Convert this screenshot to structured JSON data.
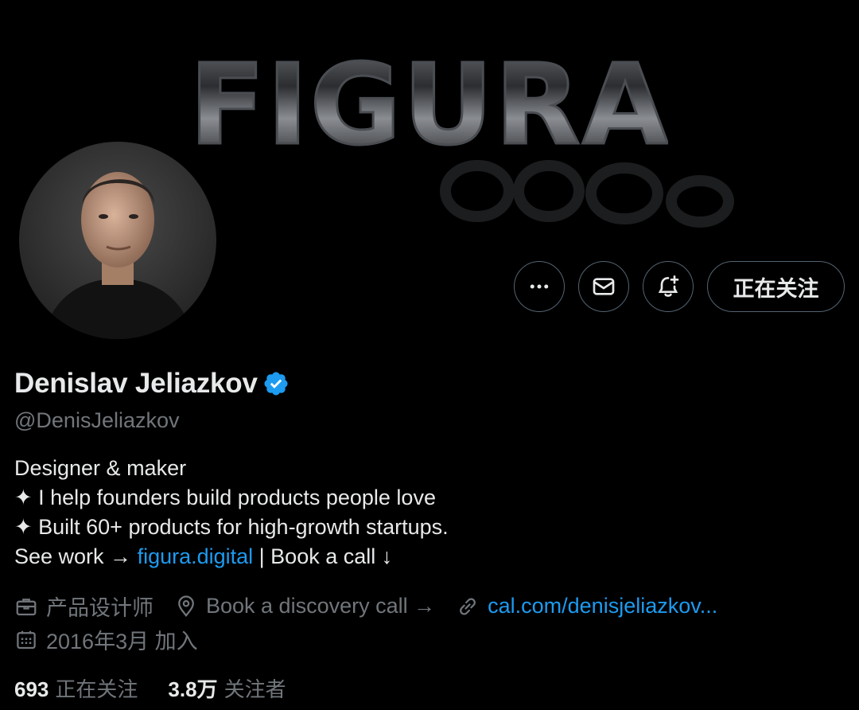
{
  "banner": {
    "logo_text": "FIGURA"
  },
  "actions": {
    "more_icon": "more-horizontal-icon",
    "message_icon": "envelope-icon",
    "notify_icon": "bell-plus-icon",
    "following_label": "正在关注"
  },
  "profile": {
    "display_name": "Denislav Jeliazkov",
    "verified_color": "#1d9bf0",
    "handle": "@DenisJeliazkov",
    "bio": {
      "line1": "Designer & maker",
      "line2": "✦ I help founders build products people love",
      "line3": "✦ Built 60+ products for high-growth startups.",
      "line4_prefix": "See work → ",
      "line4_link": "figura.digital",
      "line4_suffix": " | Book a call ↓"
    },
    "meta": {
      "profession": "产品设计师",
      "location": "Book a discovery call →",
      "website": "cal.com/denisjeliazkov...",
      "joined": "2016年3月 加入"
    },
    "counts": {
      "following_num": "693",
      "following_label": "正在关注",
      "followers_num": "3.8万",
      "followers_label": "关注者"
    }
  },
  "colors": {
    "background": "#000000",
    "text_primary": "#e7e9ea",
    "text_secondary": "#71767b",
    "link": "#1d9bf0",
    "border": "#536471"
  }
}
